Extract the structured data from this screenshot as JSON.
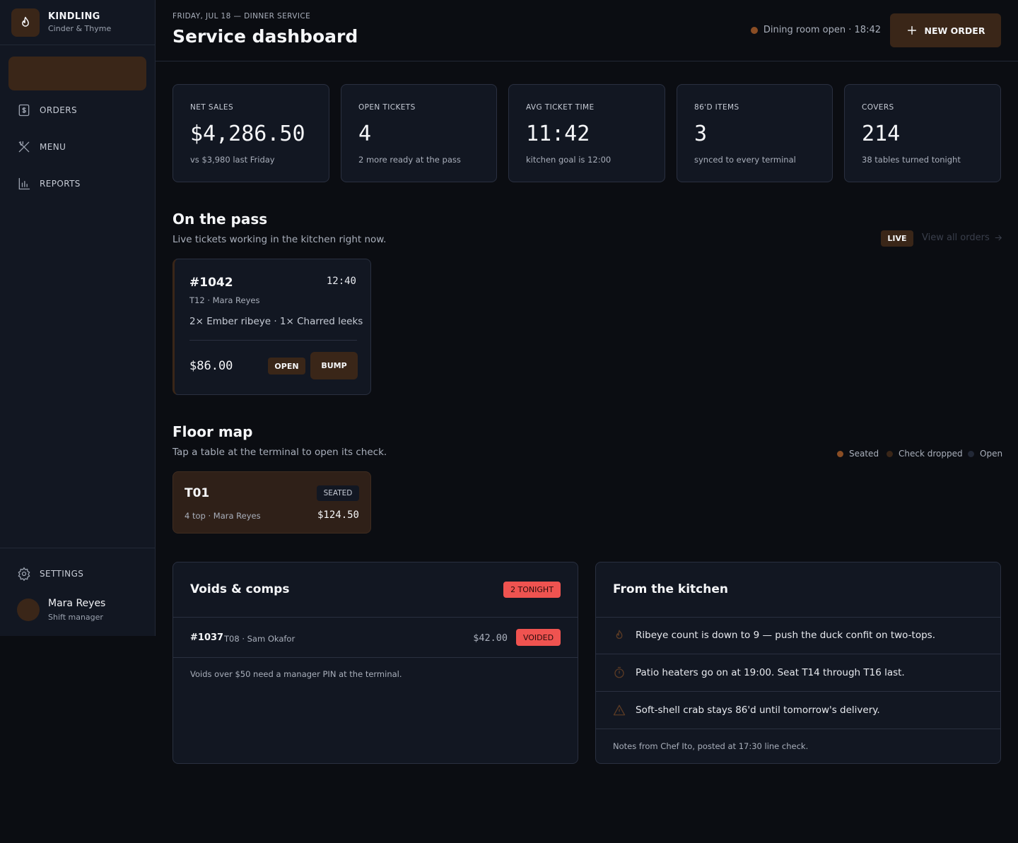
{
  "brand": {
    "name": "KINDLING",
    "sub": "Cinder & Thyme",
    "icon": "flame-icon"
  },
  "nav": {
    "items": [
      {
        "label": "ORDERS",
        "icon": "receipt-icon"
      },
      {
        "label": "MENU",
        "icon": "utensils-icon"
      },
      {
        "label": "REPORTS",
        "icon": "bar-chart-icon"
      }
    ],
    "settings": {
      "label": "SETTINGS",
      "icon": "gear-icon"
    }
  },
  "user": {
    "name": "Mara Reyes",
    "role": "Shift manager"
  },
  "header": {
    "eyebrow": "FRIDAY, JUL 18 — DINNER SERVICE",
    "title": "Service dashboard",
    "status": "Dining room open · 18:42",
    "new_order": "NEW ORDER"
  },
  "kpis": [
    {
      "label": "NET SALES",
      "value": "$4,286.50",
      "sub": "vs $3,980 last Friday"
    },
    {
      "label": "OPEN TICKETS",
      "value": "4",
      "sub": "2 more ready at the pass"
    },
    {
      "label": "AVG TICKET TIME",
      "value": "11:42",
      "sub": "kitchen goal is 12:00"
    },
    {
      "label": "86'D ITEMS",
      "value": "3",
      "sub": "synced to every terminal"
    },
    {
      "label": "COVERS",
      "value": "214",
      "sub": "38 tables turned tonight"
    }
  ],
  "pass": {
    "title": "On the pass",
    "subtitle": "Live tickets working in the kitchen right now.",
    "live": "LIVE",
    "view_all": "View all orders",
    "ticket": {
      "id": "#1042",
      "time": "12:40",
      "meta": "T12 · Mara Reyes",
      "items": "2× Ember ribeye · 1× Charred leeks",
      "total": "$86.00",
      "status": "OPEN",
      "action": "BUMP"
    }
  },
  "floor": {
    "title": "Floor map",
    "subtitle": "Tap a table at the terminal to open its check.",
    "legend": [
      {
        "label": "Seated",
        "color": "#8a4d24"
      },
      {
        "label": "Check dropped",
        "color": "#3a2618"
      },
      {
        "label": "Open",
        "color": "#222836"
      }
    ],
    "table": {
      "id": "T01",
      "status": "SEATED",
      "meta": "4 top · Mara Reyes",
      "amount": "$124.50"
    }
  },
  "voids": {
    "title": "Voids & comps",
    "badge": "2 TONIGHT",
    "rows": [
      {
        "id": "#1037",
        "meta": "T08 · Sam Okafor",
        "amount": "$42.00",
        "status": "VOIDED"
      }
    ],
    "note": "Voids over $50 need a manager PIN at the terminal."
  },
  "kitchen": {
    "title": "From the kitchen",
    "notes": [
      {
        "icon": "flame-icon",
        "text": "Ribeye count is down to 9 — push the duck confit on two-tops."
      },
      {
        "icon": "timer-icon",
        "text": "Patio heaters go on at 19:00. Seat T14 through T16 last."
      },
      {
        "icon": "warning-icon",
        "text": "Soft-shell crab stays 86'd until tomorrow's delivery."
      }
    ],
    "footer": "Notes from Chef Ito, posted at 17:30 line check."
  },
  "colors": {
    "accent": "#3a2618",
    "accent_dot": "#8a4d24",
    "danger": "#ef5350",
    "bg": "#0b0d12",
    "panel": "#121722"
  }
}
